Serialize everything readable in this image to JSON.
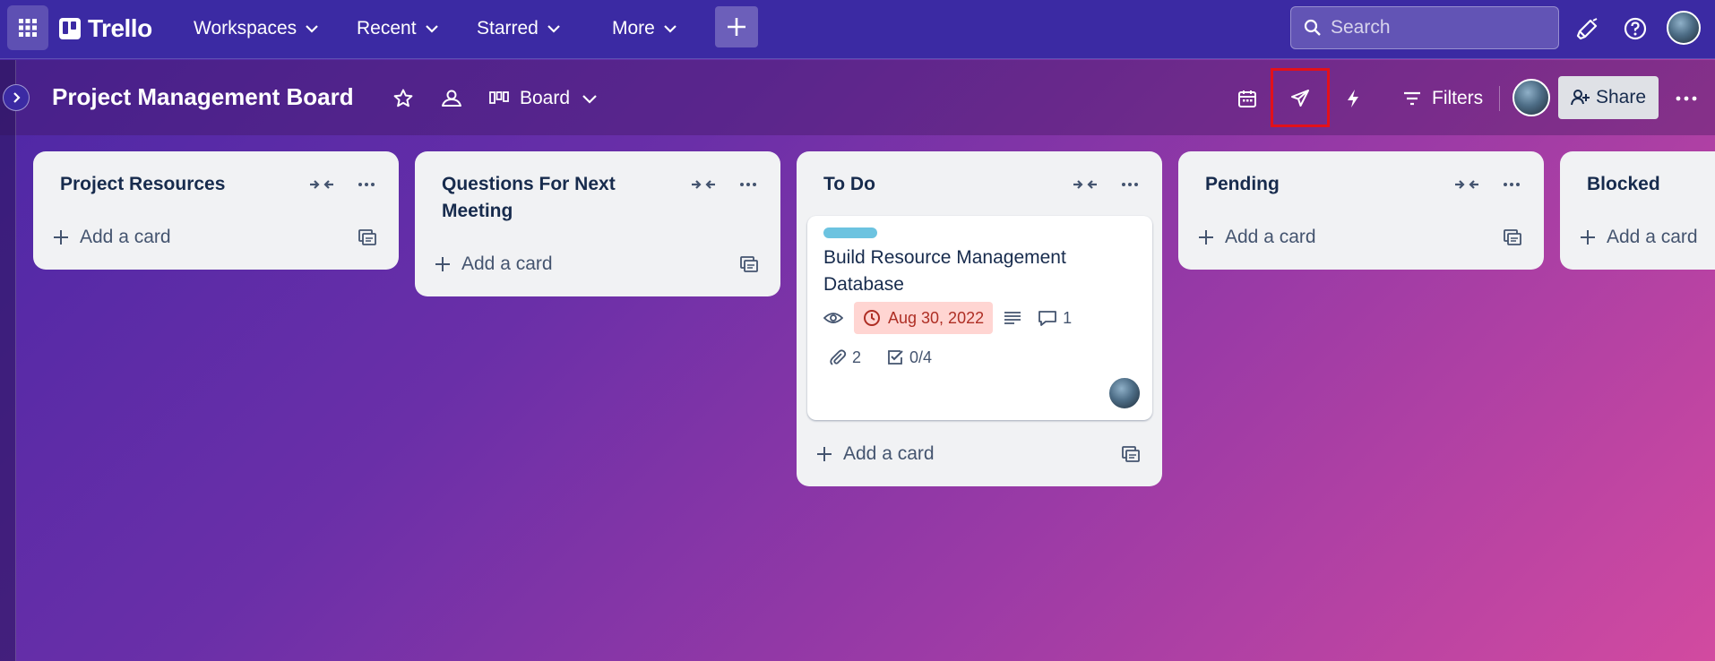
{
  "topnav": {
    "brand": "Trello",
    "menus": [
      {
        "label": "Workspaces"
      },
      {
        "label": "Recent"
      },
      {
        "label": "Starred"
      },
      {
        "label": "More"
      }
    ],
    "search_placeholder": "Search",
    "icons": [
      "apps-grid-icon",
      "plus-icon",
      "search-icon",
      "megaphone-icon",
      "help-icon"
    ]
  },
  "board": {
    "title": "Project Management Board",
    "view": "Board",
    "filters_label": "Filters",
    "share_label": "Share",
    "header_icons": [
      "star-icon",
      "workspace-visible-icon",
      "board-view-icon",
      "calendar-icon",
      "rocket-power-ups-icon",
      "automation-bolt-icon",
      "filter-icon",
      "more-icon"
    ]
  },
  "lists": [
    {
      "title": "Project Resources",
      "add_label": "Add a card"
    },
    {
      "title": "Questions For Next Meeting",
      "add_label": "Add a card"
    },
    {
      "title": "To Do",
      "add_label": "Add a card"
    },
    {
      "title": "Pending",
      "add_label": "Add a card"
    },
    {
      "title": "Blocked",
      "add_label": "Add a card"
    }
  ],
  "card": {
    "label_color": "#6cc3e0",
    "title": "Build Resource Management Database",
    "due": "Aug 30, 2022",
    "comments": "1",
    "attachments": "2",
    "checklist": "0/4"
  },
  "colors": {
    "nav": "#3b2aa3",
    "list_bg": "#f1f2f4",
    "text": "#172b4d",
    "due_bg": "#ffd5d2",
    "due_text": "#ae2e24",
    "highlight": "#e3111a"
  }
}
